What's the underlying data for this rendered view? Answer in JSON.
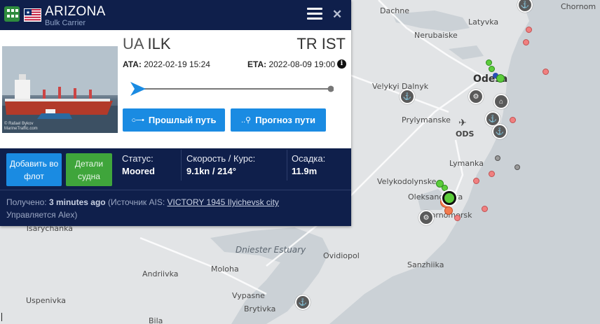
{
  "vessel": {
    "name": "ARIZONA",
    "type": "Bulk Carrier",
    "flag_icon": "liberia-flag-icon",
    "photo_credit_line1": "© Rafael Bykov",
    "photo_credit_line2": "MarineTraffic.com"
  },
  "route": {
    "from_country": "UA",
    "from_port": "ILK",
    "to_country": "TR",
    "to_port": "IST",
    "ata_label": "ATA:",
    "ata_value": "2022-02-19 15:24",
    "eta_label": "ETA:",
    "eta_value": "2022-08-09 19:00",
    "progress": 0.0
  },
  "buttons": {
    "past_track": "Прошлый путь",
    "forecast": "Прогноз пути",
    "add_to_fleet": "Добавить во флот",
    "vessel_details": "Детали судна"
  },
  "stats": {
    "status_label": "Статус:",
    "status_value": "Moored",
    "speed_label": "Скорость / Курс:",
    "speed_value": "9.1kn / 214°",
    "draught_label": "Осадка:",
    "draught_value": "11.9m"
  },
  "received": {
    "prefix": "Получено: ",
    "time": "3 minutes ago",
    "source_prefix": " (Источник AIS: ",
    "source_link": "VICTORY 1945 Ilyichevsk city",
    "managed_by": "Управляется Alex)"
  },
  "map": {
    "labels": {
      "dachne": "Dachne",
      "chornomorsk": "Chornom",
      "latyvka": "Latyvka",
      "nerubaiske": "Nerubaiske",
      "odesa": "Odesa",
      "velykyi_dalnyk": "Velykyi Dalnyk",
      "prylymanske": "Prylymanske",
      "ods": "ODS",
      "lymanka": "Lymanka",
      "velykodolynske": "Velykodolynske",
      "oleksandrivka": "Oleksandrivka",
      "chornomorsk_city": "Chornomorsk",
      "tsarychanka": "Tsarychanka",
      "dniester_estuary": "Dniester Estuary",
      "ovidiopol": "Ovidiopol",
      "sanzhiika": "Sanzhiika",
      "andriivka": "Andriivka",
      "moloha": "Moloha",
      "uspenivka": "Uspenivka",
      "vypasne": "Vypasne",
      "brytivka": "Brytivka",
      "bila": "Bila"
    },
    "colors": {
      "land": "#e2e4e6",
      "sea": "#cbd1d6",
      "vessel_green": "#5ccd3b",
      "vessel_red": "#f08080",
      "vessel_grey": "#9a9a9a"
    }
  },
  "colors": {
    "header_navy": "#0f1f4b",
    "button_blue": "#1a8be2",
    "button_green": "#3fa53b"
  }
}
